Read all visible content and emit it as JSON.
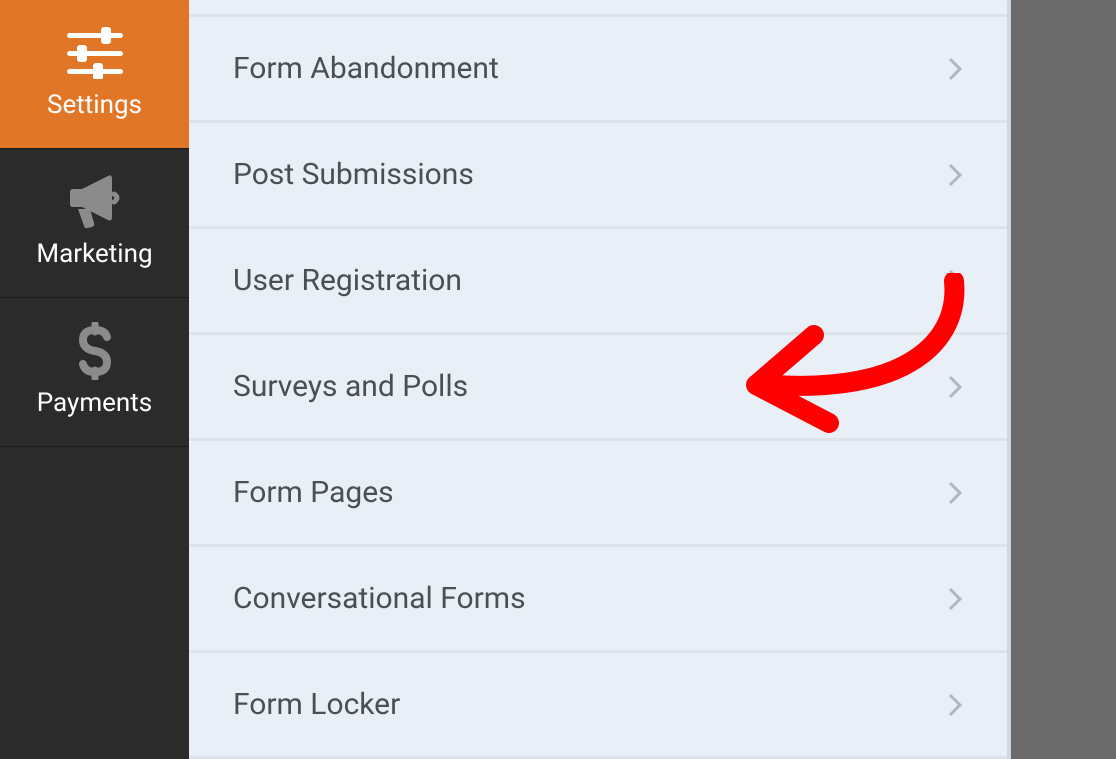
{
  "sidebar": {
    "items": [
      {
        "id": "settings",
        "label": "Settings",
        "icon": "sliders-icon",
        "active": true
      },
      {
        "id": "marketing",
        "label": "Marketing",
        "icon": "megaphone-icon",
        "active": false
      },
      {
        "id": "payments",
        "label": "Payments",
        "icon": "dollar-icon",
        "active": false
      }
    ]
  },
  "main": {
    "rows": [
      {
        "label": "Form Abandonment"
      },
      {
        "label": "Post Submissions"
      },
      {
        "label": "User Registration"
      },
      {
        "label": "Surveys and Polls"
      },
      {
        "label": "Form Pages"
      },
      {
        "label": "Conversational Forms"
      },
      {
        "label": "Form Locker"
      }
    ]
  },
  "annotation": {
    "type": "arrow",
    "color": "#ff0000",
    "points_to": "Surveys and Polls"
  }
}
